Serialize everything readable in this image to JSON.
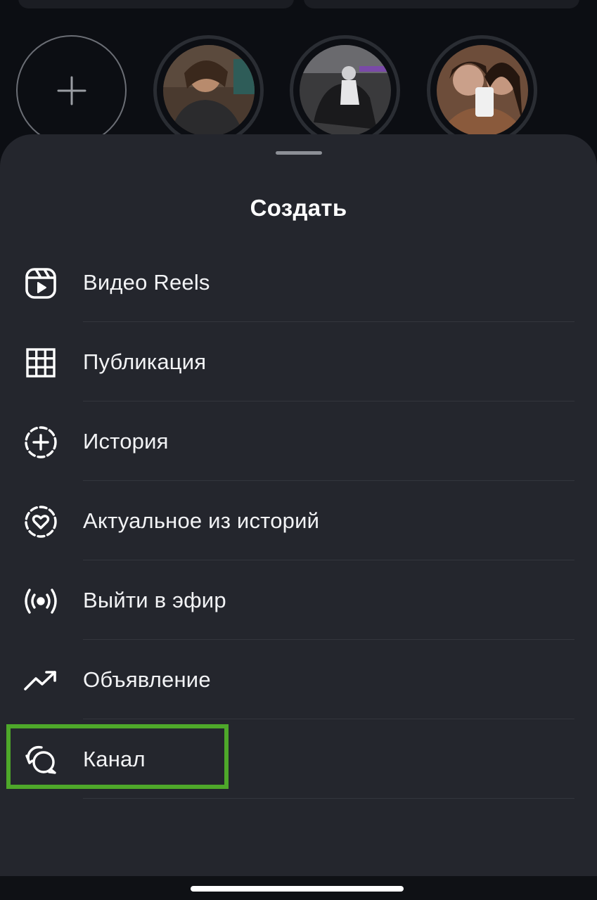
{
  "sheet": {
    "title": "Создать"
  },
  "menu": {
    "items": [
      {
        "label": "Видео Reels",
        "icon": "reels-icon"
      },
      {
        "label": "Публикация",
        "icon": "grid-icon"
      },
      {
        "label": "История",
        "icon": "story-add-icon"
      },
      {
        "label": "Актуальное из историй",
        "icon": "highlights-heart-icon"
      },
      {
        "label": "Выйти в эфир",
        "icon": "live-broadcast-icon"
      },
      {
        "label": "Объявление",
        "icon": "trending-up-icon"
      },
      {
        "label": "Канал",
        "icon": "channel-chat-icon"
      }
    ],
    "highlighted_item": "Канал"
  },
  "colors": {
    "sheet_background": "#24262d",
    "highlight_border": "#4ea82a",
    "text": "#f2f3f5"
  }
}
